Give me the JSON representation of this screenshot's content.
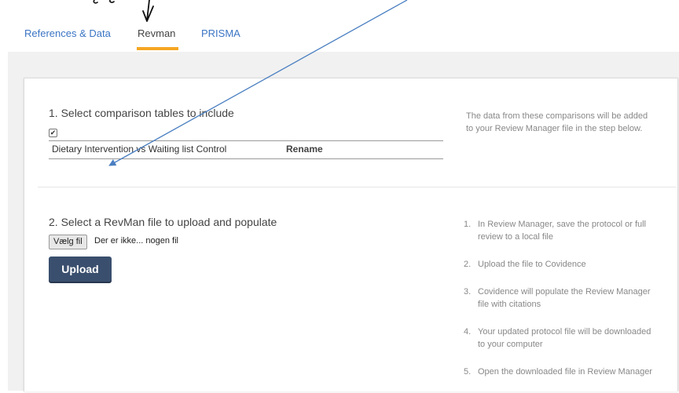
{
  "tabs": [
    {
      "label": "References & Data",
      "active": false
    },
    {
      "label": "Revman",
      "active": true
    },
    {
      "label": "PRISMA",
      "active": false
    }
  ],
  "colors": {
    "accent": "#f5a623",
    "link": "#3b75c4",
    "button": "#3a4f6e",
    "annotation_arrow": "#4a7fc1"
  },
  "section1": {
    "title": "1. Select comparison tables to include",
    "checkbox_checked": true,
    "comparisons": [
      {
        "name": "Dietary Intervention vs Waiting list Control",
        "action": "Rename"
      }
    ],
    "note": "The data from these comparisons will be added to your Review Manager file in the step below."
  },
  "section2": {
    "title": "2. Select a RevMan file to upload and populate",
    "file_button": "Vælg fil",
    "file_status": "Der er ikke... nogen fil",
    "upload_button": "Upload",
    "steps": [
      {
        "num": "1.",
        "text": "In Review Manager, save the protocol or full review to a local file"
      },
      {
        "num": "2.",
        "text": "Upload the file to Covidence"
      },
      {
        "num": "3.",
        "text": "Covidence will populate the Review Manager file with citations"
      },
      {
        "num": "4.",
        "text": "Your updated protocol file will be downloaded to your computer"
      },
      {
        "num": "5.",
        "text": "Open the downloaded file in Review Manager"
      }
    ]
  }
}
